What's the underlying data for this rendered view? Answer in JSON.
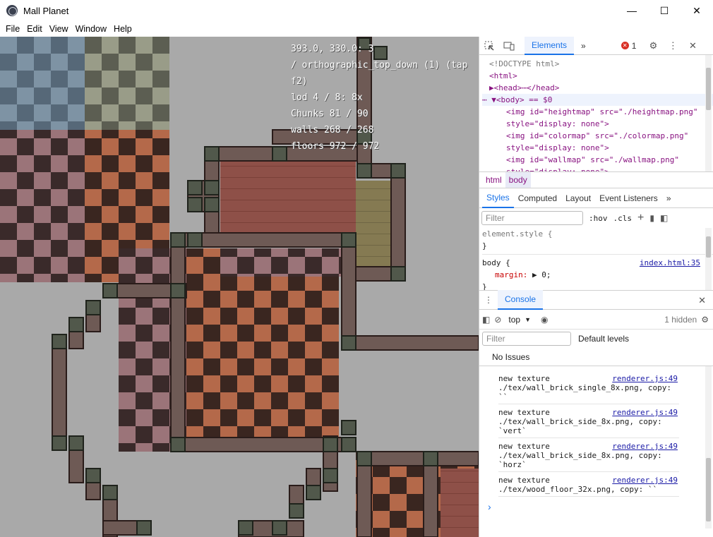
{
  "window": {
    "title": "Mall Planet",
    "controls": [
      "—",
      "☐",
      "✕"
    ],
    "menu": [
      "File",
      "Edit",
      "View",
      "Window",
      "Help"
    ]
  },
  "hud": {
    "coords": "393.0, 330.0: 3",
    "camera": "/ orthographic_top_down (1) (tap f2)",
    "lod": "lod 4 / 8: 8x",
    "chunks": "Chunks 81 / 90",
    "walls": "walls 268 / 268",
    "floors": "floors 972 / 972"
  },
  "devtools": {
    "tabs": [
      "Elements",
      "»"
    ],
    "error_count": "1",
    "dom_lines": [
      {
        "kind": "plain",
        "text": "<!DOCTYPE html>"
      },
      {
        "kind": "plain",
        "text": "<html>"
      },
      {
        "kind": "plain",
        "text": "▶<head>⋯</head>"
      },
      {
        "kind": "plain",
        "text": "⋯ ▼<body> == $0"
      },
      {
        "kind": "plain",
        "text": "<img id=\"heightmap\" src=\"./heightmap.png\""
      },
      {
        "kind": "plain",
        "text": "style=\"display: none\">"
      },
      {
        "kind": "plain",
        "text": "<img id=\"colormap\" src=\"./colormap.png\""
      },
      {
        "kind": "plain",
        "text": "style=\"display: none\">"
      },
      {
        "kind": "plain",
        "text": "<img id=\"wallmap\" src=\"./wallmap.png\""
      },
      {
        "kind": "plain",
        "text": "style=\"display: none\">"
      }
    ],
    "breadcrumbs": [
      "html",
      "body"
    ],
    "style_tabs": [
      "Styles",
      "Computed",
      "Layout",
      "Event Listeners",
      "»"
    ],
    "filter_placeholder": "Filter",
    "hov": ":hov",
    "cls": ".cls",
    "styles": {
      "rule1_selector": "element.style {",
      "rule1_close": "}",
      "rule2_selector": "body {",
      "rule2_source": "index.html:35",
      "rule2_prop": "margin:",
      "rule2_value": "▶ 0;",
      "rule2_close": "}"
    },
    "console": {
      "title": "Console",
      "context": "top",
      "filter_placeholder": "Filter",
      "levels": "Default levels",
      "hidden": "1 hidden",
      "issues": "No Issues",
      "entries": [
        {
          "msg": "new texture",
          "src": "renderer.js:49",
          "line2": "./tex/wall_brick_single_8x.png, copy:",
          "line3": "``"
        },
        {
          "msg": "new texture",
          "src": "renderer.js:49",
          "line2": "./tex/wall_brick_side_8x.png, copy:",
          "line3": "`vert`"
        },
        {
          "msg": "new texture",
          "src": "renderer.js:49",
          "line2": "./tex/wall_brick_side_8x.png, copy:",
          "line3": "`horz`"
        },
        {
          "msg": "new texture",
          "src": "renderer.js:49",
          "line2": "./tex/wood_floor_32x.png, copy: ``",
          "line3": ""
        }
      ],
      "prompt": "›"
    }
  },
  "colors": {
    "viewport_bg": "#a9a9a9",
    "accent": "#1a73e8",
    "error": "#d93025"
  }
}
